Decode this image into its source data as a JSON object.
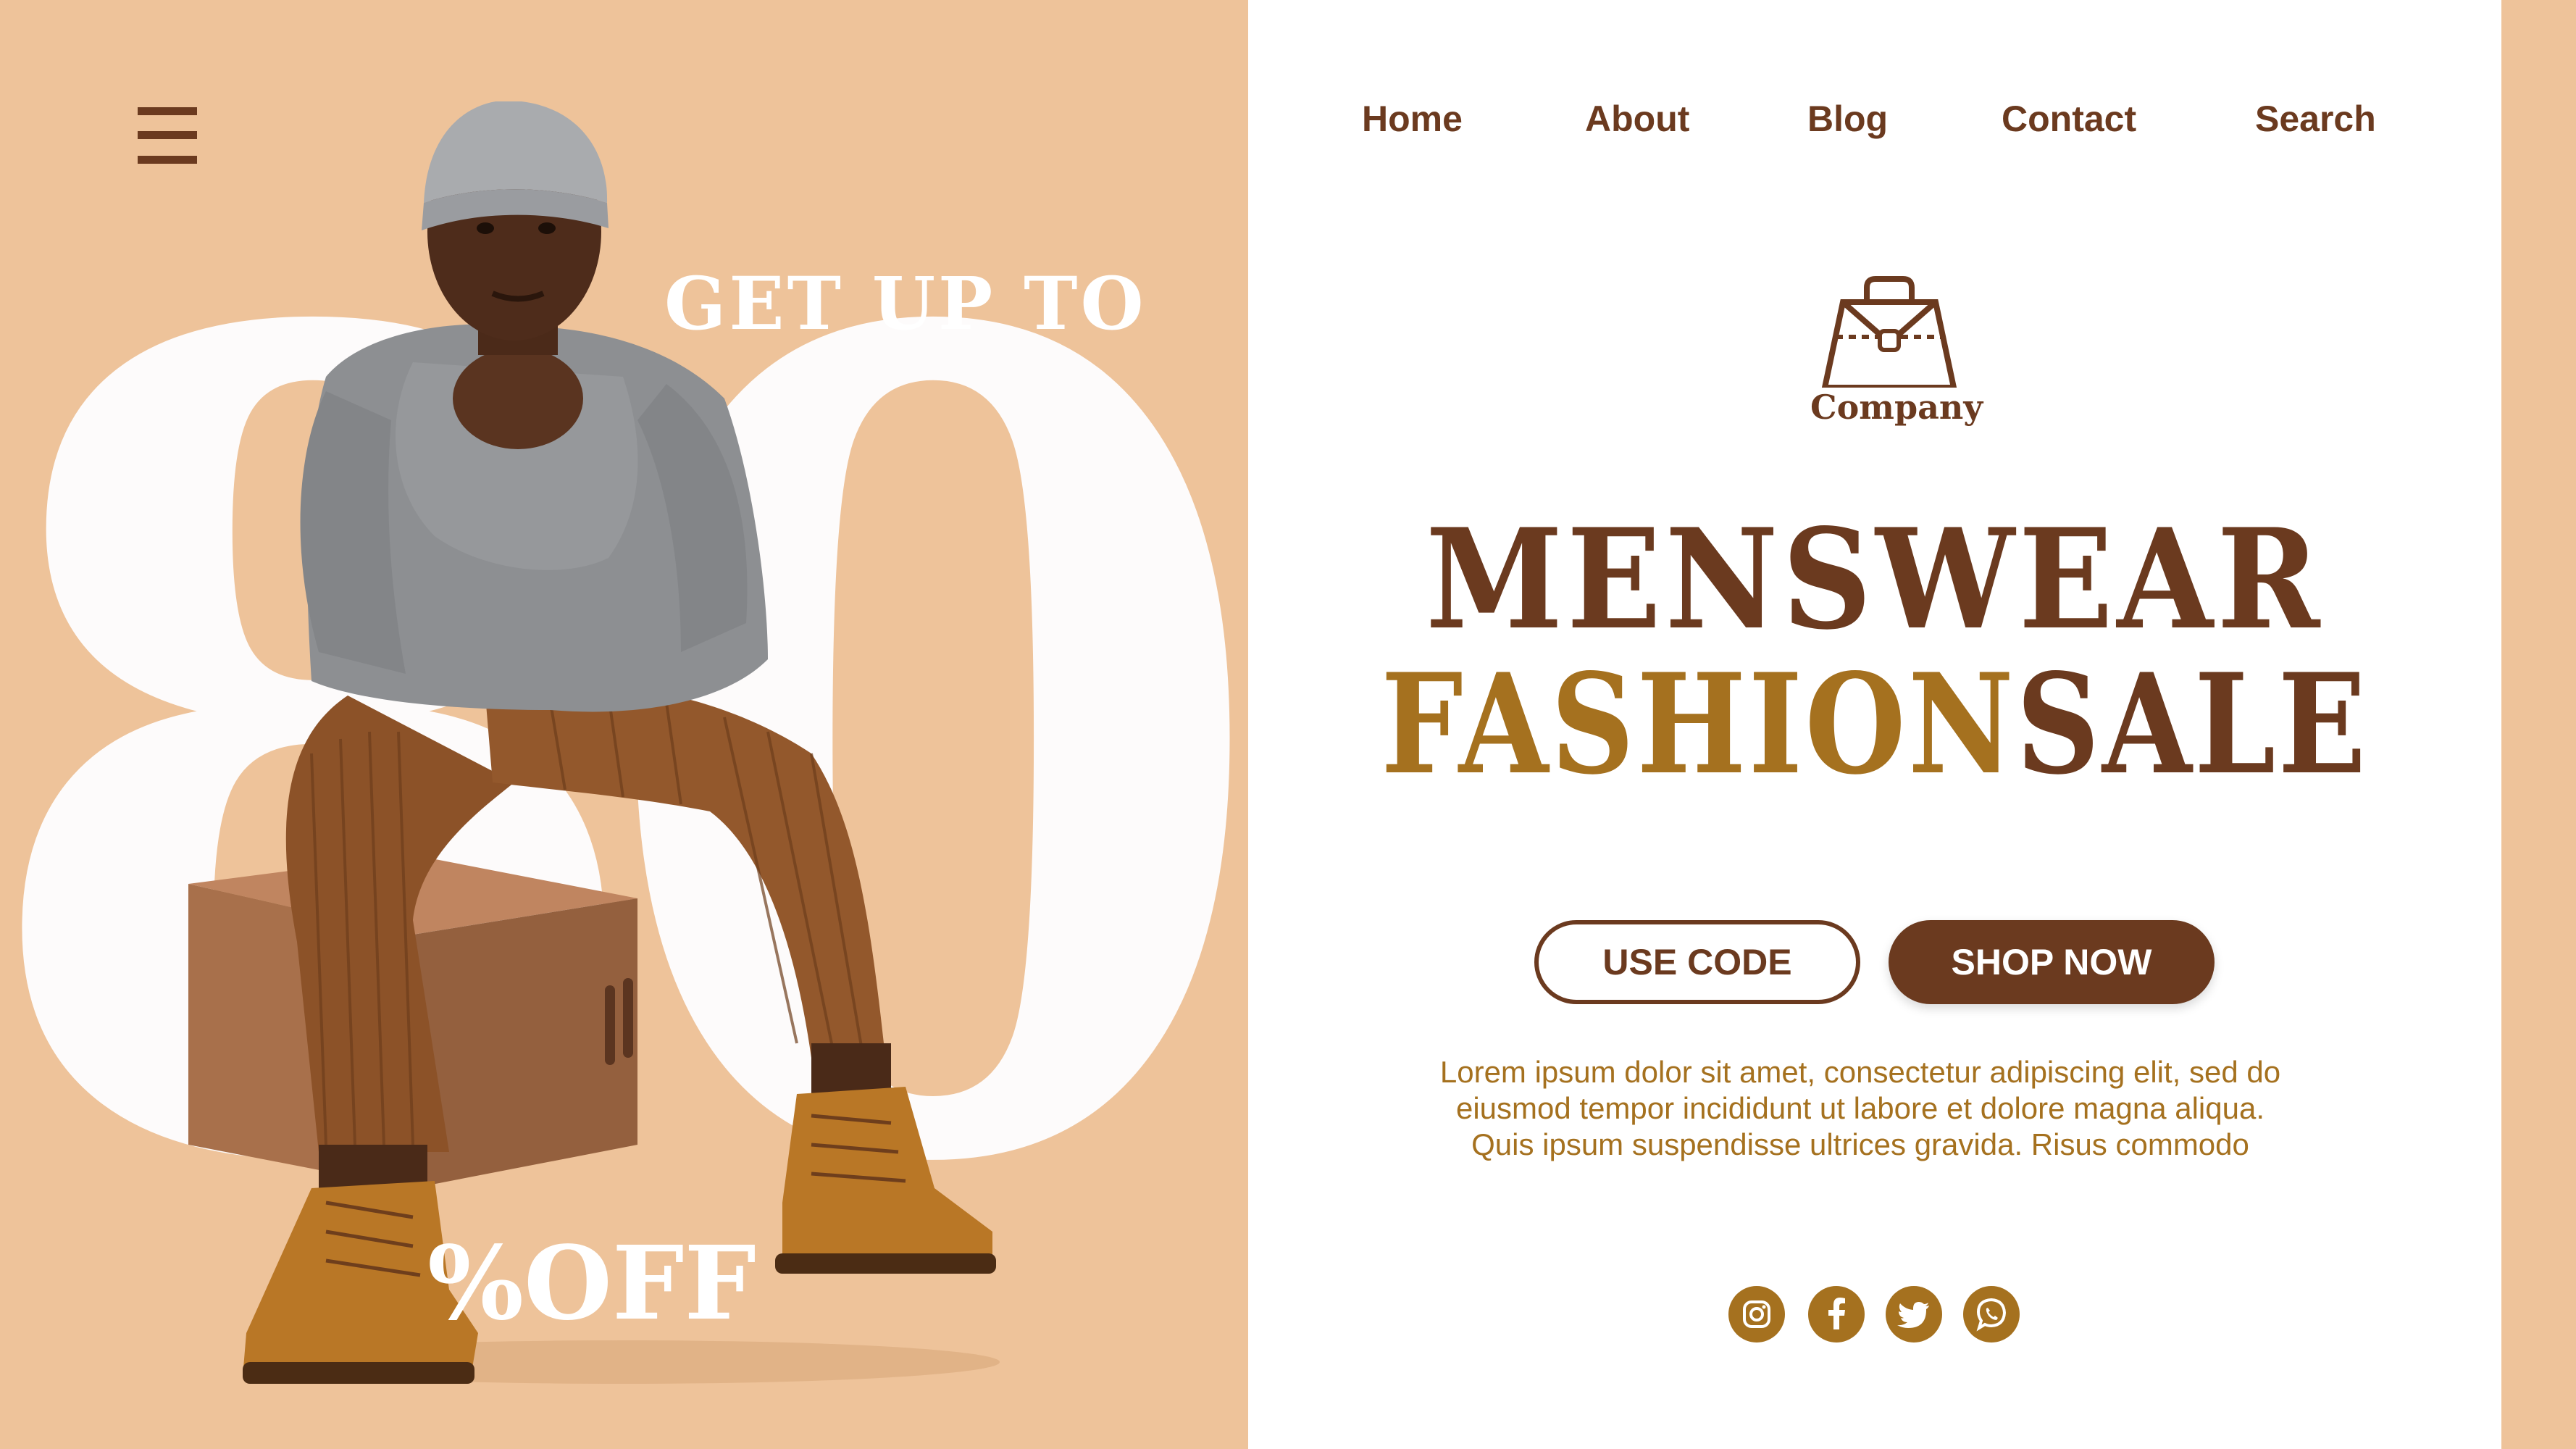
{
  "promo": {
    "big_number": "80",
    "top_text": "GET UP TO",
    "bottom_text": "%OFF"
  },
  "nav": {
    "items": [
      "Home",
      "About",
      "Blog",
      "Contact",
      "Search"
    ]
  },
  "brand": {
    "name": "Company"
  },
  "hero": {
    "title_line1": "MENSWEAR",
    "title_word_gold": "FASHION",
    "title_word_brown": "SALE"
  },
  "buttons": {
    "use_code": "USE CODE",
    "shop_now": "SHOP NOW"
  },
  "body_text": {
    "line1": "Lorem ipsum dolor sit amet, consectetur adipiscing elit, sed do",
    "line2": "eiusmod tempor incididunt ut labore et dolore magna aliqua.",
    "line3": "Quis ipsum suspendisse ultrices gravida. Risus commodo"
  },
  "social": {
    "icons": [
      "instagram-icon",
      "facebook-icon",
      "twitter-icon",
      "whatsapp-icon"
    ]
  },
  "colors": {
    "peach_background": "#eec39a",
    "brown": "#6b3a1f",
    "gold": "#a5711f",
    "white": "#ffffff"
  }
}
